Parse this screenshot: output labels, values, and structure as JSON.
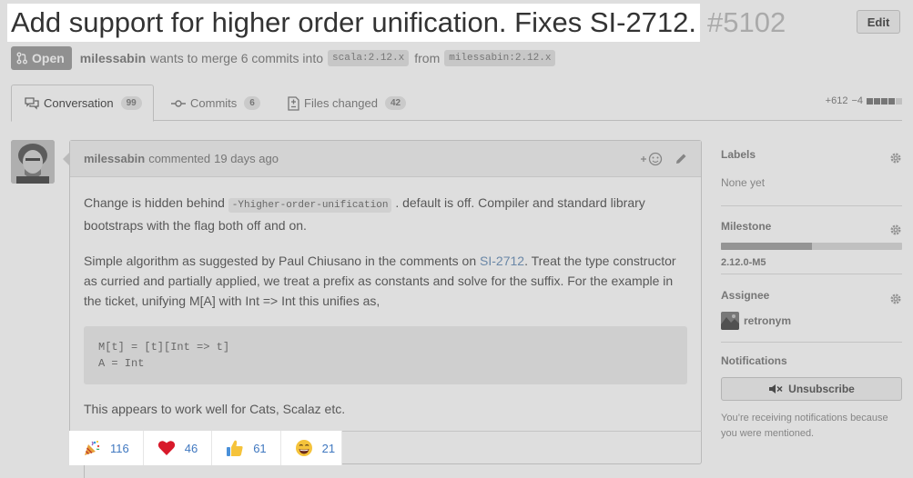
{
  "header": {
    "title": "Add support for higher order unification. Fixes SI-2712.",
    "number": "#5102",
    "edit_label": "Edit"
  },
  "meta": {
    "state": "Open",
    "author": "milessabin",
    "text_merge": "wants to merge 6 commits into",
    "base_branch": "scala:2.12.x",
    "text_from": "from",
    "head_branch": "milessabin:2.12.x"
  },
  "tabs": [
    {
      "label": "Conversation",
      "count": "99",
      "icon": "comment-discussion-icon"
    },
    {
      "label": "Commits",
      "count": "6",
      "icon": "git-commit-icon"
    },
    {
      "label": "Files changed",
      "count": "42",
      "icon": "diff-icon"
    }
  ],
  "diffstat": {
    "additions": "+612",
    "deletions": "−4"
  },
  "comment": {
    "author": "milessabin",
    "action": "commented",
    "time": "19 days ago",
    "p1_before": "Change is hidden behind",
    "p1_code": "-Yhigher-order-unification",
    "p1_after": ". default is off. Compiler and standard library bootstraps with the flag both off and on.",
    "p2_before": "Simple algorithm as suggested by Paul Chiusano in the comments on",
    "p2_link": "SI-2712",
    "p2_after": ". Treat the type constructor as curried and partially applied, we treat a prefix as constants and solve for the suffix. For the example in the ticket, unifying M[A] with Int => Int this unifies as,",
    "code_line1": "M[t] = [t][Int => t]",
    "code_line2": "A = Int",
    "p3": "This appears to work well for Cats, Scalaz etc."
  },
  "reactions": [
    {
      "emoji": "tada-icon",
      "count": "116"
    },
    {
      "emoji": "heart-icon",
      "count": "46"
    },
    {
      "emoji": "thumbsup-icon",
      "count": "61"
    },
    {
      "emoji": "smile-icon",
      "count": "21"
    }
  ],
  "sidebar": {
    "labels_heading": "Labels",
    "labels_value": "None yet",
    "milestone_heading": "Milestone",
    "milestone_name": "2.12.0-M5",
    "milestone_progress": 0.5,
    "assignee_heading": "Assignee",
    "assignee_name": "retronym",
    "notifications_heading": "Notifications",
    "unsubscribe_label": "Unsubscribe",
    "notifications_text": "You’re receiving notifications because you were mentioned."
  },
  "colors": {
    "link": "#4078c0",
    "badge": "#a6a6a6"
  }
}
